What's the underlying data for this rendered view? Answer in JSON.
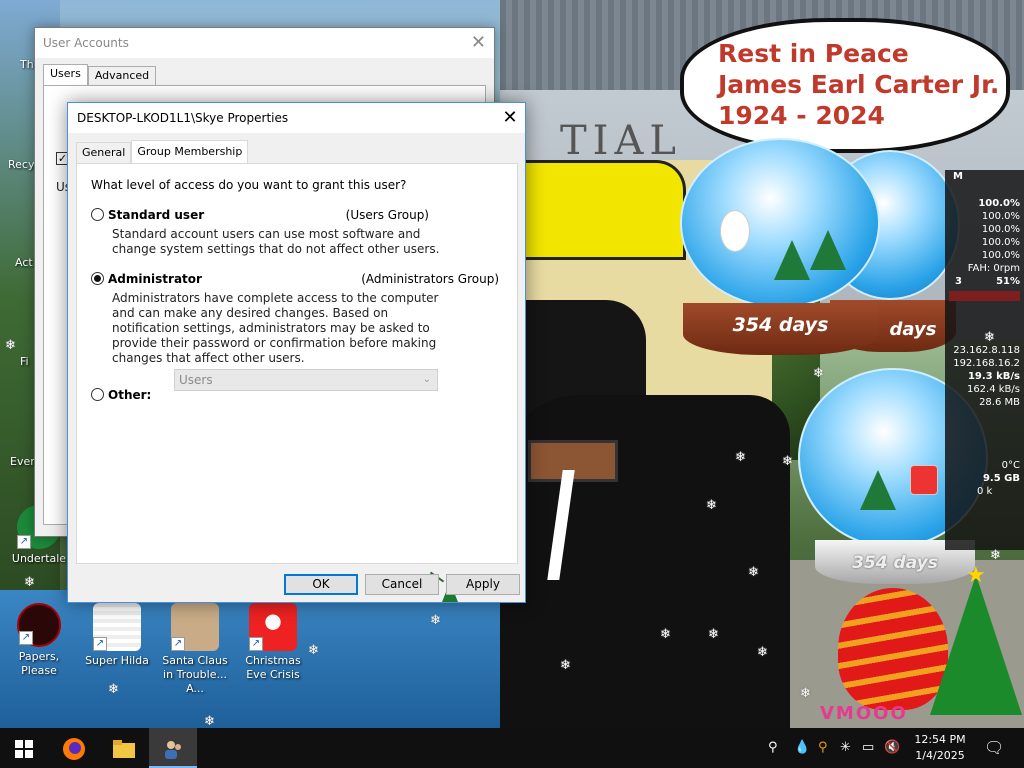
{
  "rip_banner": {
    "line1": "Rest in Peace",
    "line2": "James Earl Carter Jr.",
    "line3": "1924 - 2024"
  },
  "globes": {
    "globe1_days": "354 days",
    "globe2_days": "days",
    "globe3_days": "354 days"
  },
  "monitor": {
    "rows": [
      "M",
      "100.0%",
      "100.0%",
      "100.0%",
      "100.0%",
      "100.0%",
      "FAH: 0rpm",
      "51%"
    ],
    "net": [
      "23.162.8.118",
      "192.168.16.2",
      "19.3 kB/s",
      "162.4 kB/s",
      "28.6 MB"
    ],
    "weather": [
      "0°C",
      "9.5 GB",
      "0 k"
    ],
    "prefix_3": "3"
  },
  "desktop_icons": [
    {
      "label": "Papers, Please"
    },
    {
      "label": "Super Hilda"
    },
    {
      "label": "Santa Claus in Trouble... A..."
    },
    {
      "label": "Christmas Eve Crisis"
    },
    {
      "label": "Undertale"
    }
  ],
  "edge_labels": [
    "Th",
    "Recy",
    "Act",
    "Fi",
    "Ever"
  ],
  "bg_sign": "TIAL",
  "watermark": "VMOOO",
  "user_accounts": {
    "title": "User Accounts",
    "tabs": [
      "Users",
      "Advanced"
    ],
    "fragment_us": "Us"
  },
  "dialog": {
    "title": "DESKTOP-LKOD1L1\\Skye Properties",
    "tabs": [
      "General",
      "Group Membership"
    ],
    "question": "What level of access do you want to grant this user?",
    "options": [
      {
        "label": "Standard user",
        "group": "(Users Group)",
        "checked": false,
        "description": "Standard account users can use most software and change system settings that do not affect other users."
      },
      {
        "label": "Administrator",
        "group": "(Administrators Group)",
        "checked": true,
        "description": "Administrators have complete access to the computer and can make any desired changes. Based on notification settings, administrators may be asked to provide their password or confirmation before making changes that affect other users."
      },
      {
        "label": "Other:",
        "group": "",
        "checked": false,
        "description": ""
      }
    ],
    "other_select_value": "Users",
    "buttons": {
      "ok": "OK",
      "cancel": "Cancel",
      "apply": "Apply"
    }
  },
  "taskbar": {
    "time": "12:54 PM",
    "date": "1/4/2025"
  }
}
